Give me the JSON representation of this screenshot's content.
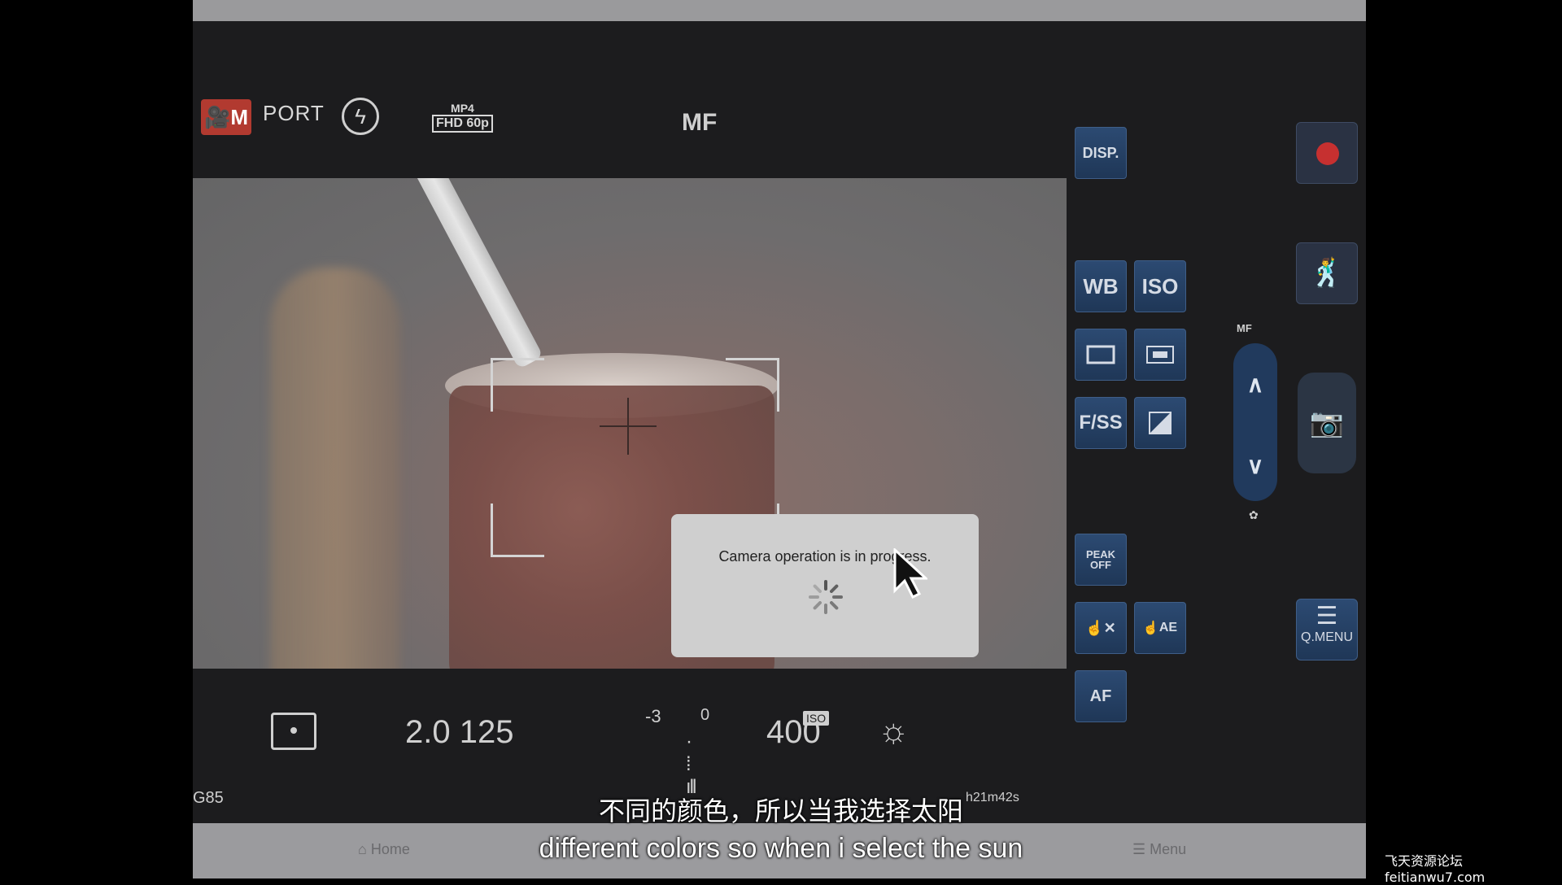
{
  "status": {
    "mode": "M",
    "photo_style": "PORT",
    "rec_format_top": "MP4",
    "rec_format_bottom": "FHD 60p",
    "focus_mode": "MF"
  },
  "dialog": {
    "message": "Camera operation is in progress."
  },
  "exposure": {
    "aperture_shutter": "2.0 125",
    "ev_left": "-3",
    "ev_zero": "0",
    "iso": "400",
    "iso_tag": "ISO"
  },
  "info": {
    "model": "G85",
    "remaining_time": "h21m42s"
  },
  "side_buttons": {
    "disp": "DISP.",
    "wb": "WB",
    "iso": "ISO",
    "fss": "F/SS",
    "peak_top": "PEAK",
    "peak_bottom": "OFF",
    "touch_ae": "AE",
    "touch_af": "AF",
    "qmenu": "Q.MENU",
    "mf_label": "MF"
  },
  "nav": {
    "home": "Home",
    "menu": "Menu"
  },
  "subtitles": {
    "chinese": "不同的颜色，所以当我选择太阳",
    "english": "different colors so when i select the sun"
  },
  "watermark": "飞天资源论坛 feitianwu7.com",
  "icons": [
    "movie-mode-icon",
    "flash-off-icon",
    "metering-icon",
    "ev-scale-icon",
    "white-balance-sun-icon",
    "record-icon",
    "scene-icon",
    "camera-icon",
    "qmenu-list-icon",
    "home-icon",
    "menu-icon",
    "chevron-up-icon",
    "chevron-down-icon",
    "macro-flower-icon",
    "cursor-arrow-icon",
    "spinner-icon"
  ]
}
